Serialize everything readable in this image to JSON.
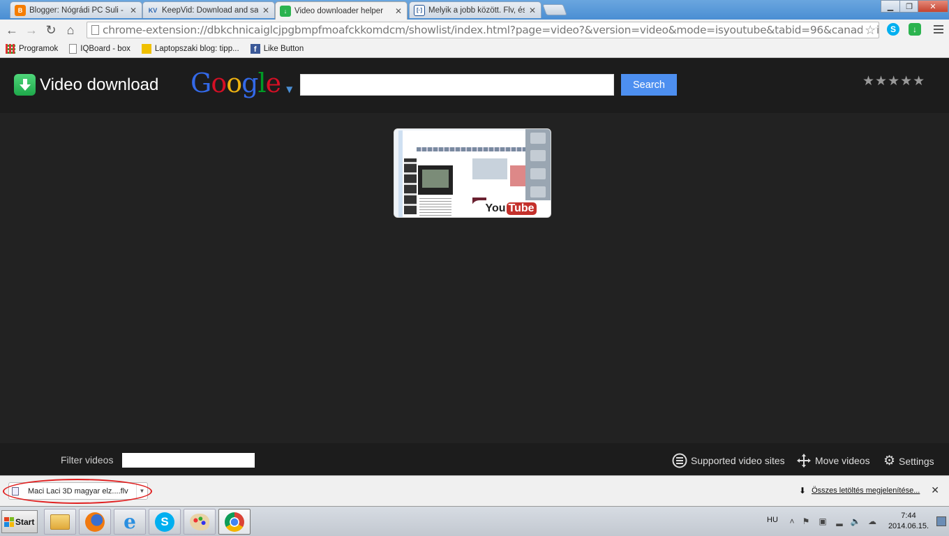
{
  "tabs": [
    {
      "title": "Blogger: Nógrádi PC Suli - Be",
      "favicon_color": "#f57d00",
      "favicon_text": "B"
    },
    {
      "title": "KeepVid: Download and save",
      "favicon_color": "#ffffff",
      "favicon_text": "KV"
    },
    {
      "title": "Video downloader helper",
      "favicon_color": "#2cb34f",
      "favicon_text": "↓"
    },
    {
      "title": "Melyik a jobb között. Flv, és",
      "favicon_color": "#1d4f91",
      "favicon_text": "[·]"
    }
  ],
  "address_bar": {
    "url": "chrome-extension://dbkchnicaiglcjpgbmpfmoafckkomdcm/showlist/index.html?page=video?&version=video&mode=isyoutube&tabid=96&canaddvideo="
  },
  "bookmarks": [
    {
      "label": "Programok",
      "icon": "apps-grid-icon"
    },
    {
      "label": "IQBoard - box",
      "icon": "page-icon"
    },
    {
      "label": "Laptopszaki blog: tipp...",
      "icon": "lsz-icon"
    },
    {
      "label": "Like Button",
      "icon": "facebook-icon"
    }
  ],
  "header": {
    "brand": "Video download",
    "google": [
      {
        "ch": "G",
        "color": "#3369e8"
      },
      {
        "ch": "o",
        "color": "#d50f25"
      },
      {
        "ch": "o",
        "color": "#eeb211"
      },
      {
        "ch": "g",
        "color": "#3369e8"
      },
      {
        "ch": "l",
        "color": "#009925"
      },
      {
        "ch": "e",
        "color": "#d50f25"
      }
    ],
    "search_value": "",
    "search_button": "Search",
    "rating_stars": "★★★★★"
  },
  "video": {
    "yt_you": "You",
    "yt_tube": "Tube"
  },
  "filterbar": {
    "filter_label": "Filter videos",
    "filter_value": "",
    "supported_sites": "Supported video sites",
    "move_videos": "Move videos",
    "settings": "Settings"
  },
  "download_shelf": {
    "file_name": "Maci Laci 3D magyar elz....flv",
    "show_all": "Összes letöltés megjelenítése..."
  },
  "taskbar": {
    "start_label": "Start",
    "language": "HU",
    "time": "7:44",
    "date": "2014.06.15."
  }
}
